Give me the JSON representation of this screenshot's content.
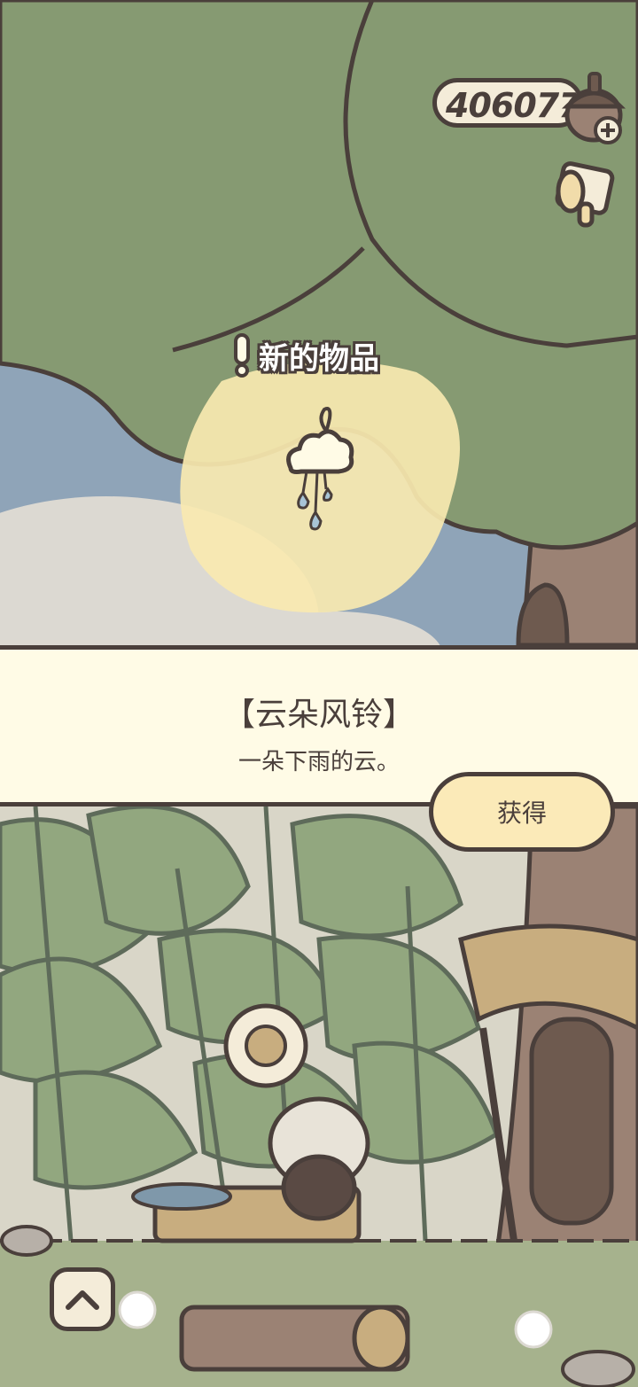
{
  "hud": {
    "acorn_count": "406077",
    "acorn_icon": "acorn-plus-icon",
    "scroll_icon": "scroll-icon"
  },
  "notification": {
    "new_item_label": "新的物品",
    "alert_icon": "exclamation-icon",
    "item_icon": "cloud-wind-chime-icon"
  },
  "item": {
    "title": "【云朵风铃】",
    "description": "一朵下雨的云。",
    "get_button_label": "获得"
  },
  "controls": {
    "up_icon": "chevron-up-icon"
  },
  "colors": {
    "outline": "#4a3f3b",
    "tree_green": "#869a72",
    "sky_blue": "#8fa4b8",
    "panel_cream": "#fffbe6",
    "button_yellow": "#fbeab8",
    "highlight_yellow": "#f8e9b0"
  }
}
